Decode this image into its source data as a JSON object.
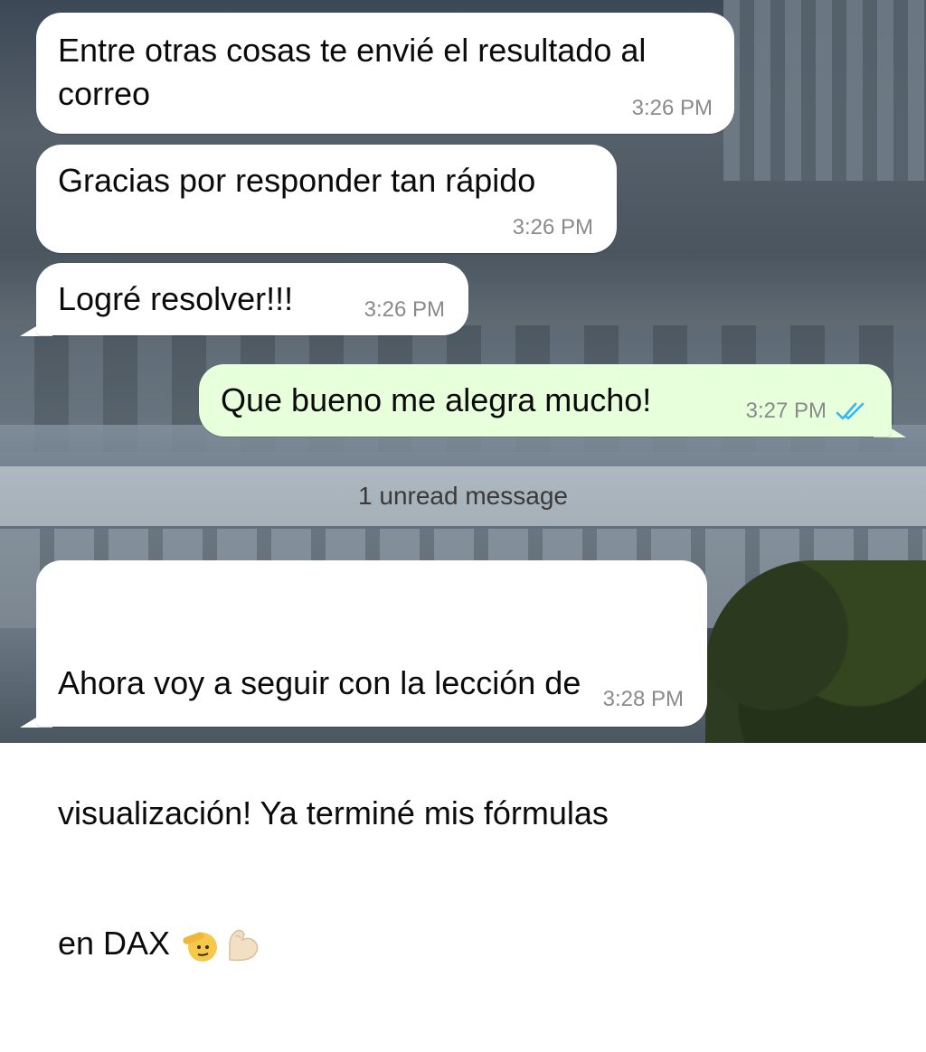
{
  "messages": [
    {
      "direction": "incoming",
      "text": "Entre otras cosas te envié el resultado al correo",
      "time": "3:26 PM"
    },
    {
      "direction": "incoming",
      "text": "Gracias por responder tan rápido",
      "time": "3:26 PM"
    },
    {
      "direction": "incoming",
      "text": "Logré resolver!!!",
      "time": "3:26 PM"
    },
    {
      "direction": "outgoing",
      "text": "Que bueno me alegra mucho!",
      "time": "3:27 PM",
      "status": "read",
      "status_icon": "double-check-icon"
    },
    {
      "direction": "incoming",
      "text_line1": "Ahora voy a seguir con la lección de",
      "text_line2": "visualización! Ya terminé mis fórmulas",
      "text_line3": "en DAX",
      "emojis": [
        "saluting-face-emoji",
        "flexed-biceps-emoji"
      ],
      "time": "3:28 PM"
    }
  ],
  "divider": {
    "label": "1 unread message"
  },
  "colors": {
    "incoming_bubble": "#ffffff",
    "outgoing_bubble": "#e7ffdb",
    "read_ticks": "#34b7f1",
    "timestamp": "#8a8a8a"
  }
}
